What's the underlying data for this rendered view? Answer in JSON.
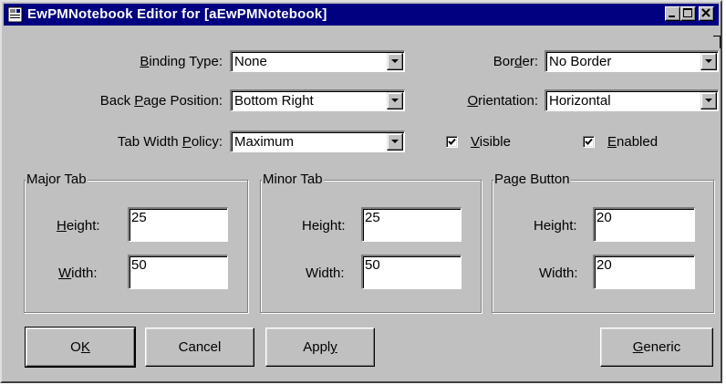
{
  "window": {
    "title": "EwPMNotebook Editor for [aEwPMNotebook]",
    "titlebar_color": "#000080",
    "face_color": "#c0c0c0"
  },
  "caption_buttons": [
    "minimize-icon",
    "maximize-icon",
    "close-icon"
  ],
  "form": {
    "binding_type": {
      "label_pre": "",
      "label_key": "B",
      "label_post": "inding Type:",
      "value": "None"
    },
    "back_page_position": {
      "label_pre": "Back ",
      "label_key": "P",
      "label_post": "age Position:",
      "value": "Bottom Right"
    },
    "tab_width_policy": {
      "label_pre": "Tab Width ",
      "label_key": "P",
      "label_post": "olicy:",
      "value": "Maximum"
    },
    "border": {
      "label_pre": "Bor",
      "label_key": "d",
      "label_post": "er:",
      "value": "No Border"
    },
    "orientation": {
      "label_pre": "",
      "label_key": "O",
      "label_post": "rientation:",
      "value": "Horizontal"
    },
    "visible": {
      "label_key": "V",
      "label_post": "isible",
      "checked": true
    },
    "enabled": {
      "label_key": "E",
      "label_post": "nabled",
      "checked": true
    }
  },
  "groups": {
    "major_tab": {
      "title": "Major Tab",
      "height": {
        "label_key": "H",
        "label_post": "eight:",
        "value": "25"
      },
      "width": {
        "label_key": "W",
        "label_post": "idth:",
        "value": "50"
      }
    },
    "minor_tab": {
      "title": "Minor Tab",
      "height": {
        "label": "Height:",
        "value": "25"
      },
      "width": {
        "label": "Width:",
        "value": "50"
      }
    },
    "page_button": {
      "title": "Page Button",
      "height": {
        "label": "Height:",
        "value": "20"
      },
      "width": {
        "label": "Width:",
        "value": "20"
      }
    }
  },
  "buttons": {
    "ok": {
      "pre": "O",
      "key": "K",
      "post": ""
    },
    "cancel": "Cancel",
    "apply": {
      "pre": "Appl",
      "key": "y",
      "post": ""
    },
    "generic": {
      "pre": "",
      "key": "G",
      "post": "eneric"
    }
  }
}
